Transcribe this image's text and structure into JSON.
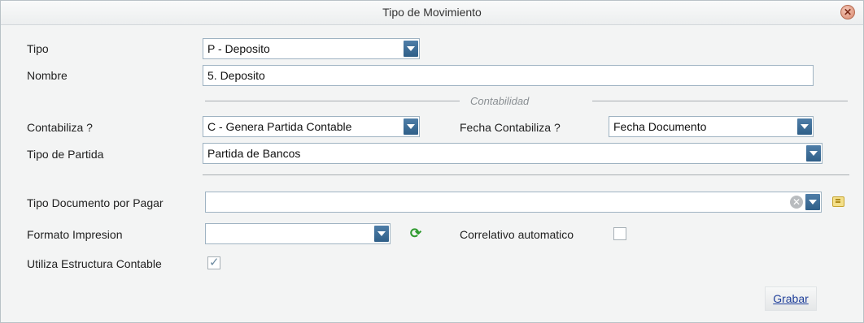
{
  "dialog": {
    "title": "Tipo de Movimiento",
    "close_icon": "close-icon"
  },
  "form": {
    "tipo": {
      "label": "Tipo",
      "value": "P - Deposito"
    },
    "nombre": {
      "label": "Nombre",
      "value": "5. Deposito"
    },
    "section_contabilidad": "Contabilidad",
    "contabiliza": {
      "label": "Contabiliza ?",
      "value": "C - Genera Partida Contable"
    },
    "fecha_contabiliza": {
      "label": "Fecha Contabiliza ?",
      "value": "Fecha Documento"
    },
    "tipo_partida": {
      "label": "Tipo de Partida",
      "value": "Partida de Bancos"
    },
    "tipo_documento": {
      "label": "Tipo Documento por Pagar",
      "value": ""
    },
    "formato_impresion": {
      "label": "Formato Impresion",
      "value": ""
    },
    "correlativo": {
      "label": "Correlativo automatico",
      "checked": false
    },
    "estructura": {
      "label": "Utiliza Estructura Contable",
      "checked": true
    }
  },
  "actions": {
    "save_label": "Grabar"
  }
}
